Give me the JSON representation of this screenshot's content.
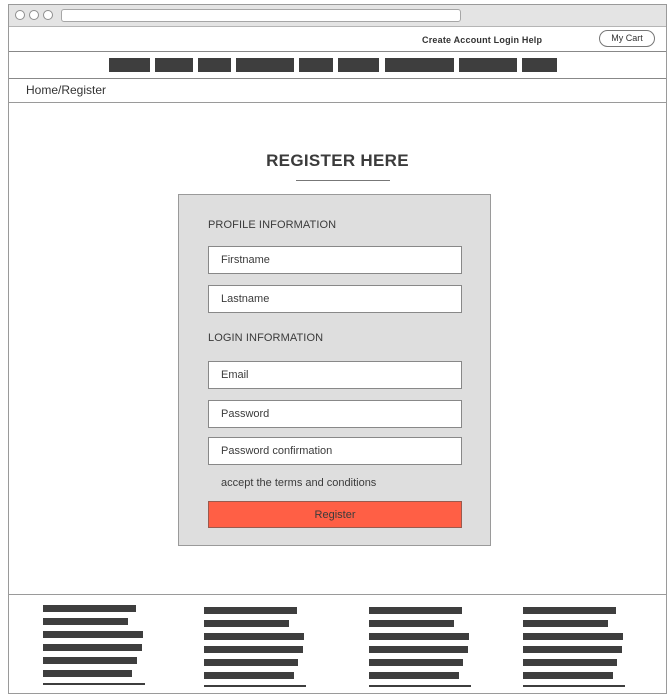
{
  "header": {
    "top_links": "Create Account Login Help",
    "cart_label": "My Cart"
  },
  "nav": {
    "item_count": 9
  },
  "breadcrumb": "Home/Register",
  "page_title": "REGISTER HERE",
  "form": {
    "profile_heading": "PROFILE INFORMATION",
    "firstname_placeholder": "Firstname",
    "lastname_placeholder": "Lastname",
    "login_heading": "LOGIN INFORMATION",
    "email_placeholder": "Email",
    "password_placeholder": "Password",
    "password_confirm_placeholder": "Password confirmation",
    "terms_label": "accept the terms and conditions",
    "submit_label": "Register"
  },
  "colors": {
    "accent": "#ff5f45",
    "panel_bg": "#dedede",
    "placeholder_block": "#3e3e3e"
  }
}
